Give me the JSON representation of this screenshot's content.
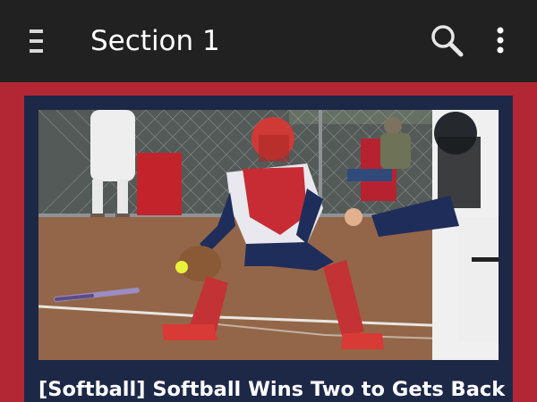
{
  "app_bar": {
    "title": "Section 1",
    "menu_icon": "hamburger-menu-icon",
    "search_icon": "search-icon",
    "overflow_icon": "more-vertical-icon"
  },
  "colors": {
    "app_bar": "#212121",
    "accent_red": "#b32735",
    "card_navy": "#1d2847",
    "text": "#ffffff"
  },
  "article": {
    "headline": "[Softball] Softball Wins Two to Gets Back"
  }
}
